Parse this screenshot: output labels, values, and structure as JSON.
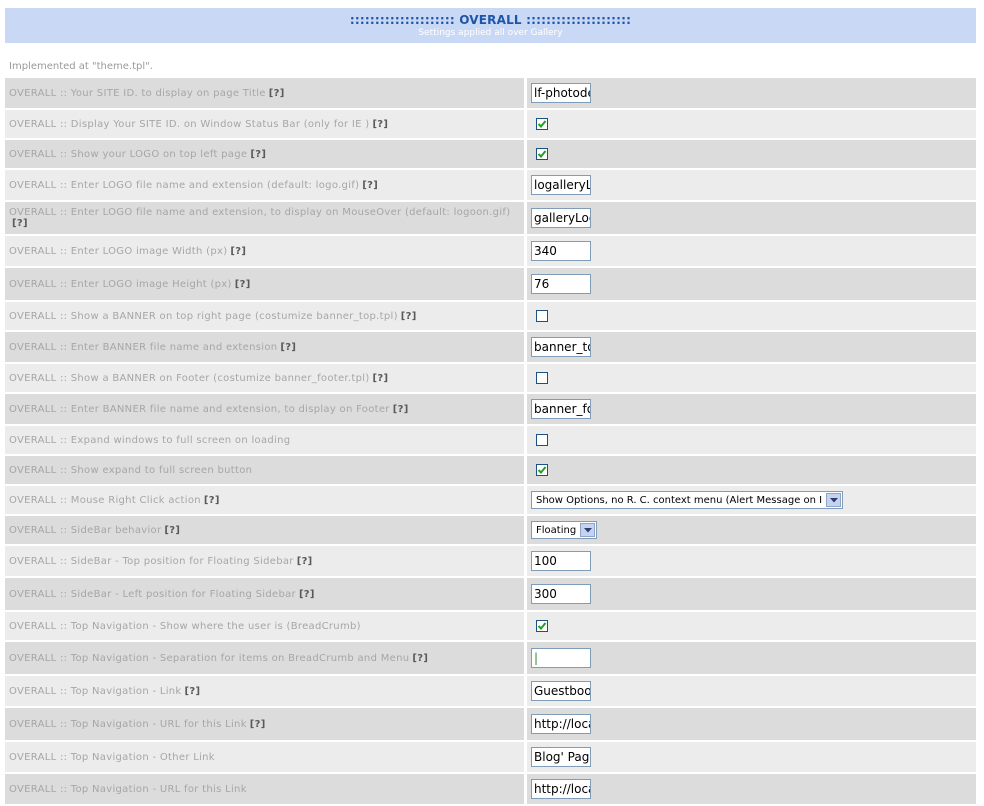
{
  "header": {
    "title": "::::::::::::::::::::: OVERALL :::::::::::::::::::::",
    "subtitle": "Settings applied all over Gallery"
  },
  "implemented": "Implemented at \"theme.tpl\".",
  "help_text": "[?]",
  "rows": [
    {
      "label": "OVERALL :: Your SITE ID. to display on page Title",
      "help": true,
      "type": "text",
      "value": "lf-photodesign"
    },
    {
      "label": "OVERALL :: Display Your SITE ID. on Window Status Bar (only for IE )",
      "help": true,
      "type": "checkbox",
      "checked": true
    },
    {
      "label": "OVERALL :: Show your LOGO on top left page",
      "help": true,
      "type": "checkbox",
      "checked": true
    },
    {
      "label": "OVERALL :: Enter LOGO file name and extension (default: logo.gif)",
      "help": true,
      "type": "text",
      "value": "logalleryLogo"
    },
    {
      "label": "OVERALL :: Enter LOGO file name and extension, to display on MouseOver (default: logoon.gif)",
      "help": true,
      "type": "text",
      "value": "galleryLogo"
    },
    {
      "label": "OVERALL :: Enter LOGO image Width (px)",
      "help": true,
      "type": "text",
      "value": "340"
    },
    {
      "label": "OVERALL :: Enter LOGO image Height (px)",
      "help": true,
      "type": "text",
      "value": "76"
    },
    {
      "label": "OVERALL :: Show a BANNER on top right page (costumize banner_top.tpl)",
      "help": true,
      "type": "checkbox",
      "checked": false
    },
    {
      "label": "OVERALL :: Enter BANNER file name and extension",
      "help": true,
      "type": "text",
      "value": "banner_top"
    },
    {
      "label": "OVERALL :: Show a BANNER on Footer (costumize banner_footer.tpl)",
      "help": true,
      "type": "checkbox",
      "checked": false
    },
    {
      "label": "OVERALL :: Enter BANNER file name and extension, to display on Footer",
      "help": true,
      "type": "text",
      "value": "banner_footer"
    },
    {
      "label": "OVERALL :: Expand windows to full screen on loading",
      "help": false,
      "type": "checkbox",
      "checked": false
    },
    {
      "label": "OVERALL :: Show expand to full screen button",
      "help": false,
      "type": "checkbox",
      "checked": true
    },
    {
      "label": "OVERALL :: Mouse Right Click action",
      "help": true,
      "type": "select",
      "value": "Show Options, no R. C. context menu (Alert Message on IE)"
    },
    {
      "label": "OVERALL :: SideBar behavior",
      "help": true,
      "type": "select",
      "value": "Floating"
    },
    {
      "label": "OVERALL :: SideBar - Top position for Floating Sidebar",
      "help": true,
      "type": "text",
      "value": "100"
    },
    {
      "label": "OVERALL :: SideBar - Left position for Floating Sidebar",
      "help": true,
      "type": "text",
      "value": "300"
    },
    {
      "label": "OVERALL :: Top Navigation - Show where the user is (BreadCrumb)",
      "help": false,
      "type": "checkbox",
      "checked": true
    },
    {
      "label": "OVERALL :: Top Navigation - Separation for items on BreadCrumb and Menu",
      "help": true,
      "type": "text",
      "value": "|"
    },
    {
      "label": "OVERALL :: Top Navigation - Link",
      "help": true,
      "type": "text",
      "value": "Guestbook"
    },
    {
      "label": "OVERALL :: Top Navigation - URL for this Link",
      "help": true,
      "type": "text",
      "value": "http://localhost"
    },
    {
      "label": "OVERALL :: Top Navigation - Other Link",
      "help": false,
      "type": "text",
      "value": "Blog' Page"
    },
    {
      "label": "OVERALL :: Top Navigation - URL for this Link",
      "help": false,
      "type": "text",
      "value": "http://localhost"
    }
  ],
  "colors": {
    "header_bg": "#c9d9f5",
    "title": "#1e55a8",
    "row_dark": "#dcdcdc",
    "row_light": "#ececec"
  }
}
